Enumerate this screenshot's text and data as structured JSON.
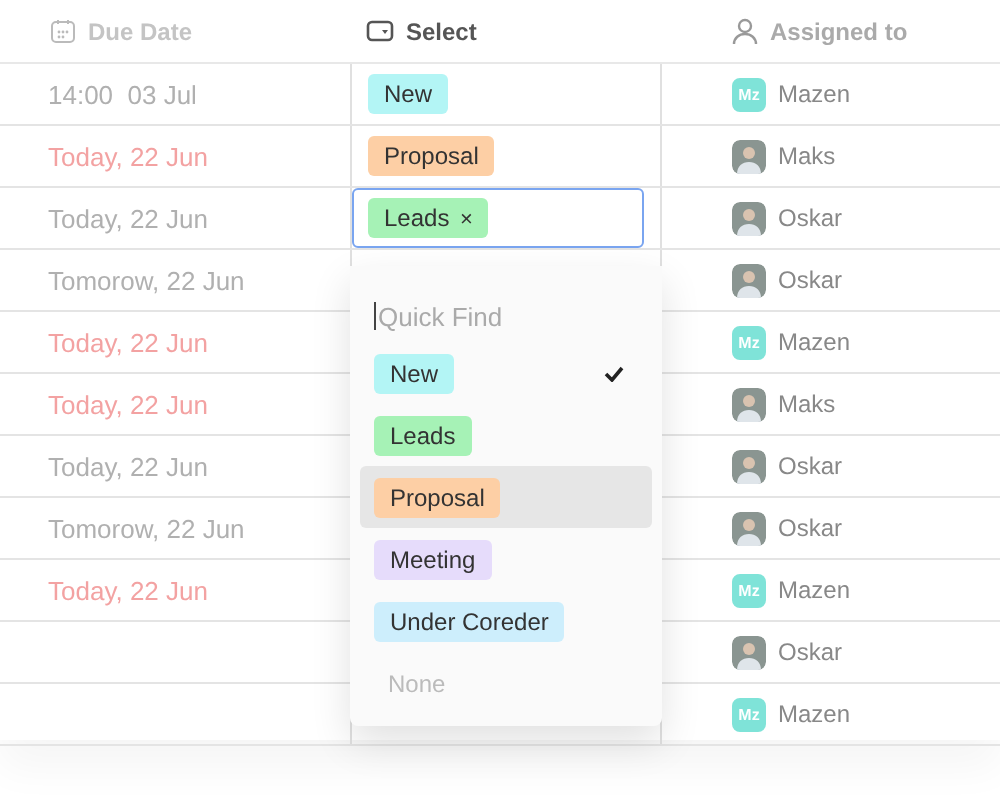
{
  "columns": [
    {
      "label": "Due Date"
    },
    {
      "label": "Select"
    },
    {
      "label": "Assigned to"
    }
  ],
  "rows": [
    {
      "due": "14:00  03 Jul",
      "overdue": false,
      "tag": {
        "label": "New",
        "color": "#b3f5f5"
      },
      "assignee": {
        "name": "Mazen",
        "kind": "initials",
        "initials": "Mz"
      }
    },
    {
      "due": "Today, 22 Jun",
      "overdue": true,
      "tag": {
        "label": "Proposal",
        "color": "#fdcfa5"
      },
      "assignee": {
        "name": "Maks",
        "kind": "photo"
      }
    },
    {
      "due": "Today, 22 Jun",
      "overdue": false,
      "editing": true,
      "tag": {
        "label": "Leads",
        "color": "#a6f2b6"
      },
      "assignee": {
        "name": "Oskar",
        "kind": "photo"
      }
    },
    {
      "due": "Tomorow, 22 Jun",
      "overdue": false,
      "assignee": {
        "name": "Oskar",
        "kind": "photo"
      }
    },
    {
      "due": "Today, 22 Jun",
      "overdue": true,
      "assignee": {
        "name": "Mazen",
        "kind": "initials",
        "initials": "Mz"
      }
    },
    {
      "due": "Today, 22 Jun",
      "overdue": true,
      "assignee": {
        "name": "Maks",
        "kind": "photo"
      }
    },
    {
      "due": "Today, 22 Jun",
      "overdue": false,
      "assignee": {
        "name": "Oskar",
        "kind": "photo"
      }
    },
    {
      "due": "Tomorow, 22 Jun",
      "overdue": false,
      "assignee": {
        "name": "Oskar",
        "kind": "photo"
      }
    },
    {
      "due": "Today, 22 Jun",
      "overdue": true,
      "assignee": {
        "name": "Mazen",
        "kind": "initials",
        "initials": "Mz"
      }
    },
    {
      "assignee": {
        "name": "Oskar",
        "kind": "photo"
      }
    },
    {
      "assignee": {
        "name": "Mazen",
        "kind": "initials",
        "initials": "Mz"
      }
    }
  ],
  "dropdown": {
    "placeholder": "Quick Find",
    "remove_symbol": "×",
    "options": [
      {
        "label": "New",
        "color": "#b3f5f5",
        "checked": true,
        "hovered": false
      },
      {
        "label": "Leads",
        "color": "#a6f2b6",
        "checked": false,
        "hovered": false
      },
      {
        "label": "Proposal",
        "color": "#fdcfa5",
        "checked": false,
        "hovered": true
      },
      {
        "label": "Meeting",
        "color": "#e6dcfb",
        "checked": false,
        "hovered": false
      },
      {
        "label": "Under Coreder",
        "color": "#cdeefc",
        "checked": false,
        "hovered": false
      }
    ],
    "none_label": "None"
  }
}
